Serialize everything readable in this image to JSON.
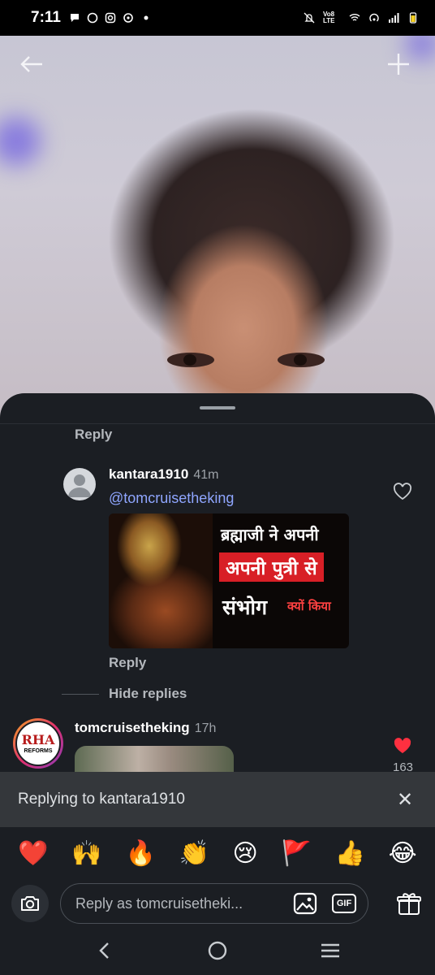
{
  "status_bar": {
    "time": "7:11",
    "notification_icons": [
      "chat-bubble-icon",
      "whatsapp-icon",
      "instagram-icon",
      "threads-icon",
      "dot-icon"
    ],
    "system_icons": [
      "mute-icon",
      "volte-icon",
      "wifi-icon",
      "hotspot-icon",
      "signal-icon",
      "battery-icon"
    ],
    "volte_label": "Vo8 LTE"
  },
  "top_bar": {
    "back_icon": "arrow-left-icon",
    "add_icon": "plus-icon"
  },
  "comments": {
    "prev_reply_label": "Reply",
    "reply1": {
      "username": "kantara1910",
      "time": "41m",
      "mention": "@tomcruisetheking",
      "image_text": {
        "line1": "ब्रह्माजी ने अपनी",
        "line2": "अपनी पुत्री से",
        "line3": "संभोग",
        "line4": "क्यों किया"
      },
      "reply_label": "Reply"
    },
    "hide_replies_label": "Hide replies",
    "comment2": {
      "username": "tomcruisetheking",
      "time": "17h",
      "avatar_logo": "RHA",
      "avatar_sub": "REFORMS",
      "like_count": "163"
    }
  },
  "replying_bar": {
    "text": "Replying to kantara1910",
    "close_icon": "close-icon"
  },
  "emoji_row": [
    "❤️",
    "🙌",
    "🔥",
    "👏",
    "😢",
    "🚩",
    "👍",
    "😂"
  ],
  "composer": {
    "placeholder": "Reply as tomcruisetheki...",
    "camera_icon": "camera-icon",
    "image_icon": "image-icon",
    "gif_label": "GIF",
    "gift_icon": "gift-icon"
  },
  "nav": [
    "back-icon",
    "home-icon",
    "recents-icon"
  ],
  "colors": {
    "sheet_bg": "#1b1e23",
    "mention": "#8fa6ff",
    "like_red": "#ff3040",
    "reply_bar_bg": "#34373b"
  }
}
